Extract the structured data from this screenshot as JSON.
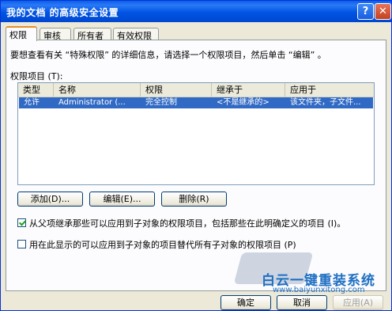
{
  "window": {
    "title": "我的文档 的高级安全设置"
  },
  "titlebar": {
    "help_glyph": "?",
    "close_glyph": "✕"
  },
  "tabs": [
    {
      "label": "权限"
    },
    {
      "label": "审核"
    },
    {
      "label": "所有者"
    },
    {
      "label": "有效权限"
    }
  ],
  "intro_text": "要想查看有关 “特殊权限” 的详细信息，请选择一个权限项目，然后单击 “编辑” 。",
  "list_label": "权限项目 (T):",
  "columns": [
    "类型",
    "名称",
    "权限",
    "继承于",
    "应用于"
  ],
  "rows": [
    {
      "type": "允许",
      "name": "Administrator (...",
      "permission": "完全控制",
      "inherited": "<不是继承的>",
      "applies": "该文件夹，子文件..."
    }
  ],
  "buttons": {
    "add": "添加(D)...",
    "edit": "编辑(E)...",
    "remove": "删除(R)",
    "ok": "确定",
    "cancel": "取消",
    "apply": "应用(A)"
  },
  "options": {
    "inherit_label": "从父项继承那些可以应用到子对象的权限项目，包括那些在此明确定义的项目 (I)。",
    "inherit_checked": true,
    "replace_label": "用在此显示的可以应用到子对象的项目替代所有子对象的权限项目 (P)",
    "replace_checked": false
  },
  "watermark": {
    "brand": "白云一键重装系统",
    "url": "www.baiyunxitong.com"
  }
}
